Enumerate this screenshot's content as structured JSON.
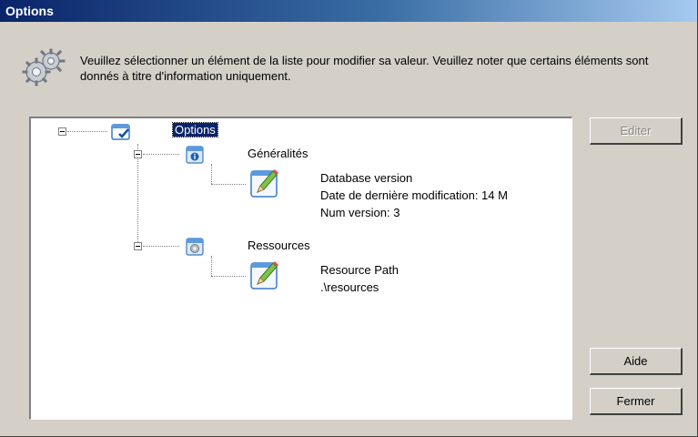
{
  "window": {
    "title": "Options"
  },
  "header": {
    "icon": "gears-icon",
    "description": "Veuillez sélectionner un élément de la liste pour modifier sa valeur. Veuillez noter que certains éléments sont donnés à titre d'information uniquement."
  },
  "tree": {
    "root": {
      "label": "Options",
      "icon": "options-checklist-icon",
      "expanded": true,
      "selected": true
    },
    "groups": [
      {
        "label": "Généralités",
        "icon": "info-window-icon",
        "expanded": true,
        "items": [
          "Database version",
          "Date de dernière modification: 14 M",
          "Num version: 3"
        ]
      },
      {
        "label": "Ressources",
        "icon": "settings-window-icon",
        "expanded": true,
        "items": [
          "Resource Path",
          ".\\resources"
        ]
      }
    ]
  },
  "buttons": {
    "edit": "Editer",
    "help": "Aide",
    "close": "Fermer"
  },
  "colors": {
    "titlebar_start": "#0a246a",
    "titlebar_end": "#a6caf0",
    "face": "#d4d0c8",
    "selection": "#0a246a"
  }
}
